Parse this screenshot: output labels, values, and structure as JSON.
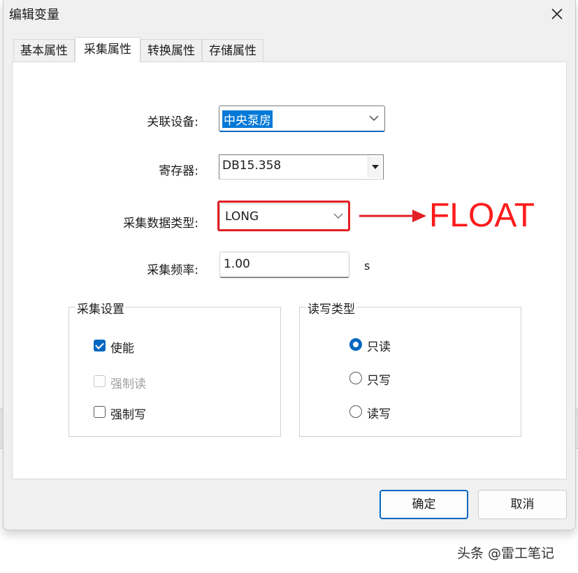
{
  "dialog": {
    "title": "编辑变量"
  },
  "tabs": [
    {
      "label": "基本属性",
      "active": false
    },
    {
      "label": "采集属性",
      "active": true
    },
    {
      "label": "转换属性",
      "active": false
    },
    {
      "label": "存储属性",
      "active": false
    }
  ],
  "form": {
    "device_label": "关联设备:",
    "device_value": "中央泵房",
    "register_label": "寄存器:",
    "register_value": "DB15.358",
    "datatype_label": "采集数据类型:",
    "datatype_value": "LONG",
    "frequency_label": "采集频率:",
    "frequency_value": "1.00",
    "frequency_unit": "s"
  },
  "annotation": {
    "text": "FLOAT",
    "color": "#ff1a1a"
  },
  "collect_settings": {
    "title": "采集设置",
    "options": [
      {
        "label": "使能",
        "checked": true,
        "disabled": false
      },
      {
        "label": "强制读",
        "checked": false,
        "disabled": true
      },
      {
        "label": "强制写",
        "checked": false,
        "disabled": false
      }
    ]
  },
  "rw_type": {
    "title": "读写类型",
    "options": [
      {
        "label": "只读",
        "selected": true
      },
      {
        "label": "只写",
        "selected": false
      },
      {
        "label": "读写",
        "selected": false
      }
    ]
  },
  "buttons": {
    "ok": "确定",
    "cancel": "取消"
  },
  "watermark": "头条 @雷工笔记",
  "colors": {
    "accent": "#0067c0",
    "highlight": "#e31e24"
  }
}
